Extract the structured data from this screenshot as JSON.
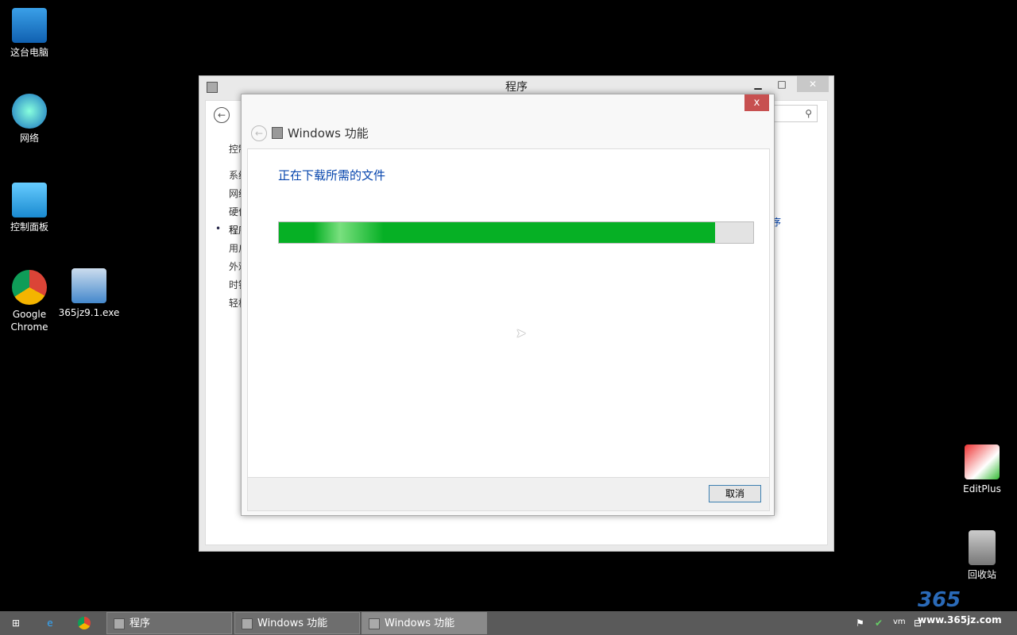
{
  "desktop": {
    "icons": [
      {
        "label": "这台电脑",
        "icon": "computer-icon"
      },
      {
        "label": "网络",
        "icon": "network-icon"
      },
      {
        "label": "控制面板",
        "icon": "control-panel-icon"
      },
      {
        "label": "Google Chrome",
        "icon": "chrome-icon"
      },
      {
        "label": "365jz9.1.exe",
        "icon": "installer-icon"
      },
      {
        "label": "EditPlus",
        "icon": "editplus-icon"
      },
      {
        "label": "回收站",
        "icon": "recycle-bin-icon"
      }
    ]
  },
  "programs_window": {
    "title": "程序",
    "sidebar": [
      "控制",
      "系统",
      "网络",
      "硬件",
      "程序",
      "用户",
      "外观",
      "时钟",
      "轻松"
    ],
    "right_link": "序"
  },
  "dialog": {
    "title": "Windows 功能",
    "message": "正在下载所需的文件",
    "progress_percent": 92,
    "cancel_label": "取消",
    "close_label": "x",
    "progress_color": "#06b025"
  },
  "taskbar": {
    "items": [
      {
        "label": "程序"
      },
      {
        "label": "Windows 功能"
      },
      {
        "label": "Windows 功能"
      }
    ]
  },
  "watermark": {
    "text": "365建站 www.365jz.com"
  }
}
